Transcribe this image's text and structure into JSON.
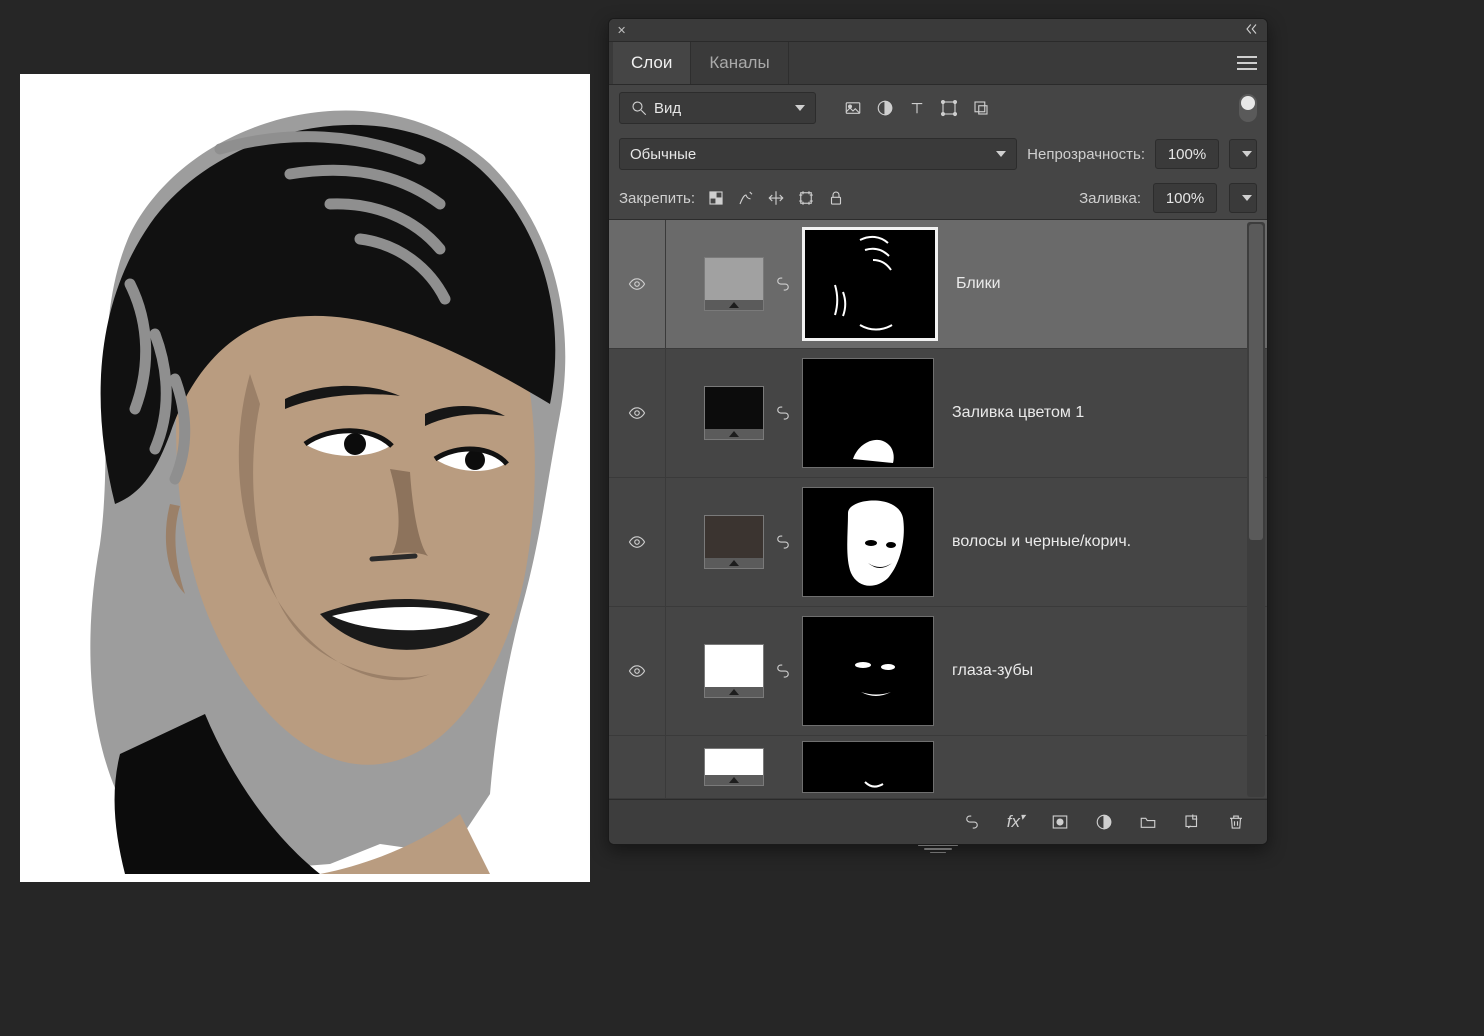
{
  "panel": {
    "tabs": {
      "layers": "Слои",
      "channels": "Каналы"
    },
    "search": {
      "placeholder": "Вид"
    },
    "blend_mode": "Обычные",
    "opacity_label": "Непрозрачность:",
    "opacity_value": "100%",
    "lock_label": "Закрепить:",
    "fill_label": "Заливка:",
    "fill_value": "100%"
  },
  "layers": [
    {
      "name": "Блики",
      "swatch_color": "#a1a1a1",
      "selected": true
    },
    {
      "name": "Заливка цветом 1",
      "swatch_color": "#0c0c0c",
      "selected": false
    },
    {
      "name": "волосы и черные/корич.",
      "swatch_color": "#3b3430",
      "selected": false
    },
    {
      "name": "глаза-зубы",
      "swatch_color": "#ffffff",
      "selected": false
    },
    {
      "name": "",
      "swatch_color": "#ffffff",
      "selected": false,
      "partial": true
    }
  ],
  "footer_icons": [
    "link",
    "fx",
    "mask",
    "adjustment",
    "group",
    "new-layer",
    "trash"
  ]
}
